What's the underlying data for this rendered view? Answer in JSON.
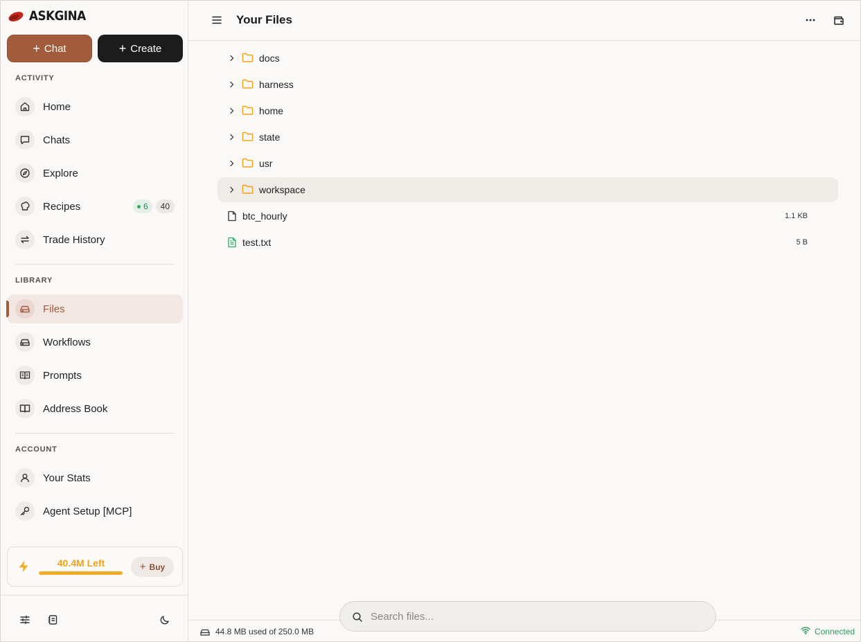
{
  "brand": {
    "name": "ASKGINA"
  },
  "actions": {
    "chat_label": "Chat",
    "create_label": "Create"
  },
  "sections": {
    "activity": "ACTIVITY",
    "library": "LIBRARY",
    "account": "ACCOUNT"
  },
  "activity_items": [
    {
      "label": "Home",
      "icon": "home-icon"
    },
    {
      "label": "Chats",
      "icon": "chat-bubble-icon"
    },
    {
      "label": "Explore",
      "icon": "compass-icon"
    },
    {
      "label": "Recipes",
      "icon": "chef-hat-icon",
      "badge_active": "6",
      "badge_total": "40"
    },
    {
      "label": "Trade History",
      "icon": "swap-arrows-icon"
    }
  ],
  "library_items": [
    {
      "label": "Files",
      "icon": "drive-icon",
      "active": true
    },
    {
      "label": "Workflows",
      "icon": "drive-icon"
    },
    {
      "label": "Prompts",
      "icon": "open-book-icon"
    },
    {
      "label": "Address Book",
      "icon": "book-icon"
    }
  ],
  "account_items": [
    {
      "label": "Your Stats",
      "icon": "user-icon"
    },
    {
      "label": "Agent Setup [MCP]",
      "icon": "key-icon"
    }
  ],
  "credits": {
    "amount": "40.4M Left",
    "buy_label": "Buy",
    "fill_fraction": 1.0,
    "accent": "#f2ad24"
  },
  "main": {
    "title": "Your Files"
  },
  "folders": [
    {
      "name": "docs"
    },
    {
      "name": "harness"
    },
    {
      "name": "home"
    },
    {
      "name": "state"
    },
    {
      "name": "usr"
    },
    {
      "name": "workspace",
      "highlighted": true
    }
  ],
  "files": [
    {
      "name": "btc_hourly",
      "size": "1.1 KB",
      "icon": "file-icon"
    },
    {
      "name": "test.txt",
      "size": "5 B",
      "icon": "text-file-icon"
    }
  ],
  "search": {
    "placeholder": "Search files..."
  },
  "status": {
    "usage": "44.8 MB used of 250.0 MB",
    "connection": "Connected",
    "connection_color": "#2f9a5e"
  },
  "colors": {
    "brand_accent": "#a05c3c",
    "logo_red": "#c0261b"
  }
}
